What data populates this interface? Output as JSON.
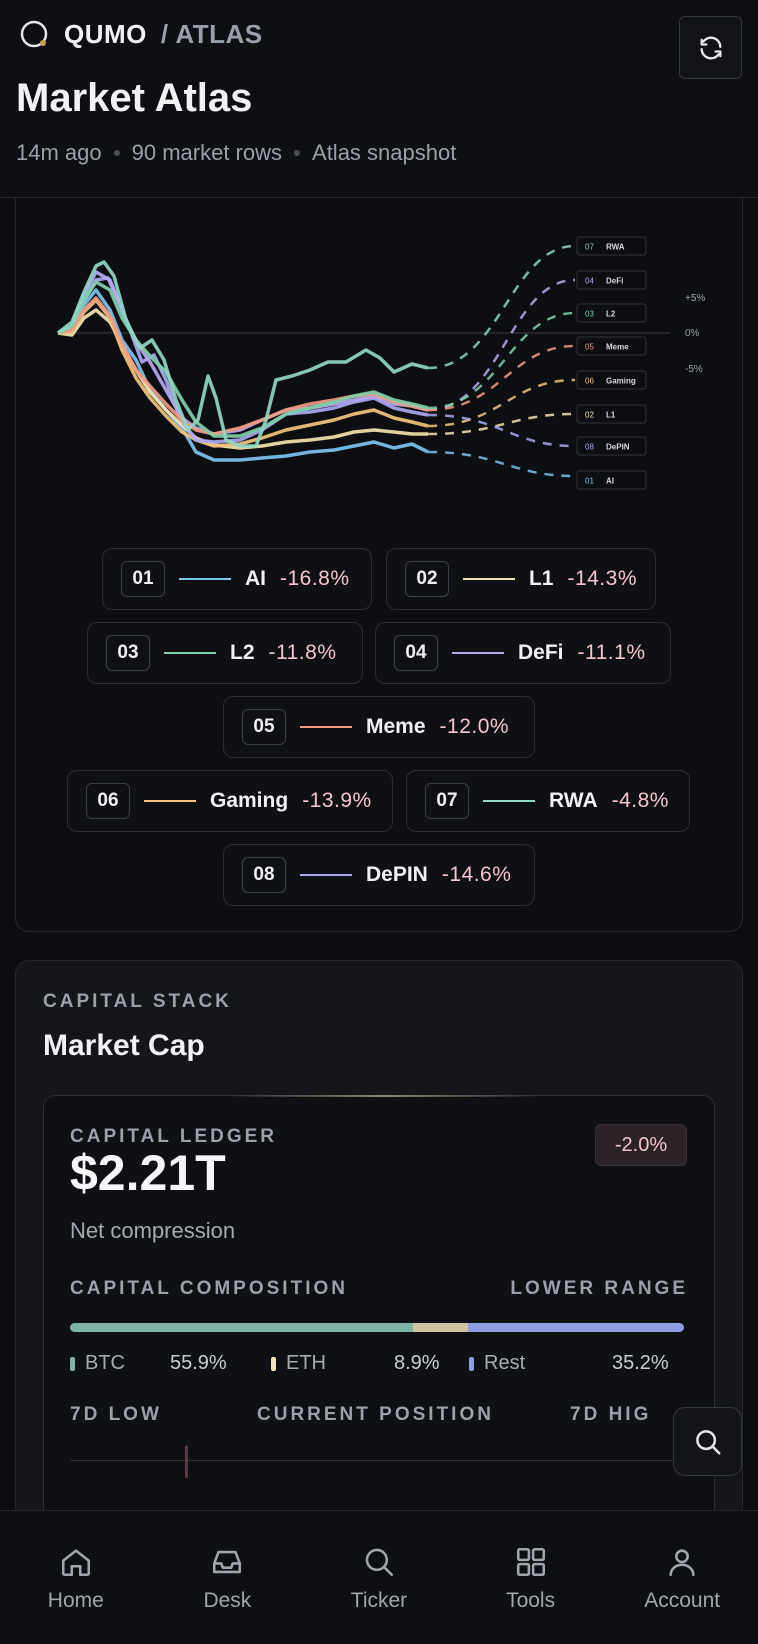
{
  "header": {
    "brand": "QUMO",
    "section": "/ ATLAS",
    "title": "Market Atlas",
    "meta": [
      "14m ago",
      "90 market rows",
      "Atlas snapshot"
    ]
  },
  "chart_data": {
    "type": "line",
    "reference_labels": [
      "+5%",
      "0%",
      "-5%"
    ],
    "end_labels": [
      {
        "num": "07",
        "name": "RWA",
        "color": "#8fc7b7"
      },
      {
        "num": "04",
        "name": "DeFi",
        "color": "#b7a9f0"
      },
      {
        "num": "03",
        "name": "L2",
        "color": "#7fcfa8"
      },
      {
        "num": "05",
        "name": "Meme",
        "color": "#f09a80"
      },
      {
        "num": "06",
        "name": "Gaming",
        "color": "#f2c47e"
      },
      {
        "num": "02",
        "name": "L1",
        "color": "#f3e2b0"
      },
      {
        "num": "08",
        "name": "DePIN",
        "color": "#a9a8f2"
      },
      {
        "num": "01",
        "name": "AI",
        "color": "#7cc3ee"
      }
    ]
  },
  "legend_chips": [
    {
      "num": "01",
      "name": "AI",
      "value": "-16.8%",
      "color": "#7cc3ee"
    },
    {
      "num": "02",
      "name": "L1",
      "value": "-14.3%",
      "color": "#f3e2b0"
    },
    {
      "num": "03",
      "name": "L2",
      "value": "-11.8%",
      "color": "#7fcfa8"
    },
    {
      "num": "04",
      "name": "DeFi",
      "value": "-11.1%",
      "color": "#b7a9f0"
    },
    {
      "num": "05",
      "name": "Meme",
      "value": "-12.0%",
      "color": "#f09a80"
    },
    {
      "num": "06",
      "name": "Gaming",
      "value": "-13.9%",
      "color": "#f2c47e"
    },
    {
      "num": "07",
      "name": "RWA",
      "value": "-4.8%",
      "color": "#8fd6c6"
    },
    {
      "num": "08",
      "name": "DePIN",
      "value": "-14.6%",
      "color": "#a9a8f2"
    }
  ],
  "capital": {
    "eyebrow": "CAPITAL STACK",
    "title": "Market Cap",
    "ledger_label": "CAPITAL LEDGER",
    "value": "$2.21T",
    "subtitle": "Net compression",
    "change": "-2.0%",
    "composition_label": "CAPITAL COMPOSITION",
    "range_label": "LOWER RANGE",
    "composition": [
      {
        "name": "BTC",
        "value": "55.9%",
        "fraction": 0.559,
        "color": "#7fb3a3"
      },
      {
        "name": "ETH",
        "value": "8.9%",
        "fraction": 0.089,
        "color": "#cfc4a0"
      },
      {
        "name": "Rest",
        "value": "35.2%",
        "fraction": 0.352,
        "color": "#8c9ee0"
      }
    ],
    "range_row": [
      "7D LOW",
      "CURRENT POSITION",
      "7D HIG"
    ]
  },
  "nav": [
    {
      "label": "Home",
      "icon": "home-icon"
    },
    {
      "label": "Desk",
      "icon": "inbox-icon"
    },
    {
      "label": "Ticker",
      "icon": "search-icon"
    },
    {
      "label": "Tools",
      "icon": "grid-icon"
    },
    {
      "label": "Account",
      "icon": "user-icon"
    }
  ]
}
